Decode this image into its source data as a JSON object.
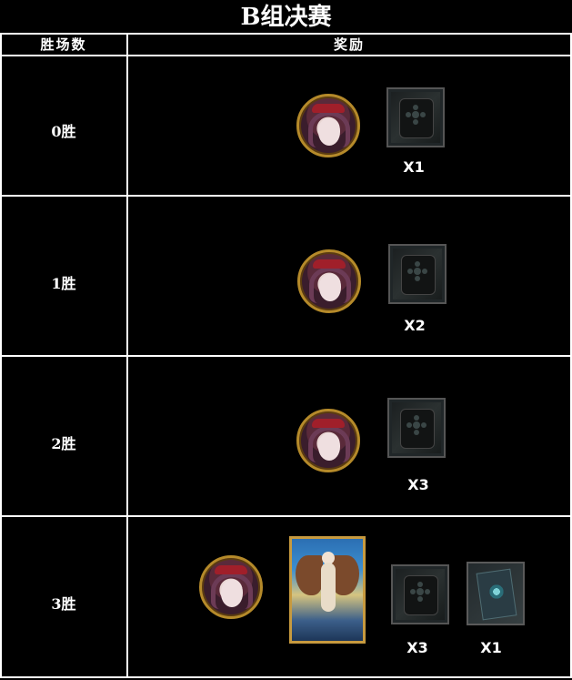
{
  "title": "B组决赛",
  "header": {
    "col_wins": "胜场数",
    "col_rewards": "奖励"
  },
  "rows": [
    {
      "wins": "0胜",
      "rewards": [
        {
          "icon": "avatar-icon"
        },
        {
          "icon": "card-back-icon",
          "qty": "X1"
        }
      ]
    },
    {
      "wins": "1胜",
      "rewards": [
        {
          "icon": "avatar-icon"
        },
        {
          "icon": "card-back-icon",
          "qty": "X2"
        }
      ]
    },
    {
      "wins": "2胜",
      "rewards": [
        {
          "icon": "avatar-icon"
        },
        {
          "icon": "card-back-icon",
          "qty": "X3"
        }
      ]
    },
    {
      "wins": "3胜",
      "rewards": [
        {
          "icon": "avatar-icon"
        },
        {
          "icon": "hero-card-icon"
        },
        {
          "icon": "card-back-icon",
          "qty": "X3"
        },
        {
          "icon": "blue-card-back-icon",
          "qty": "X1"
        }
      ]
    }
  ]
}
